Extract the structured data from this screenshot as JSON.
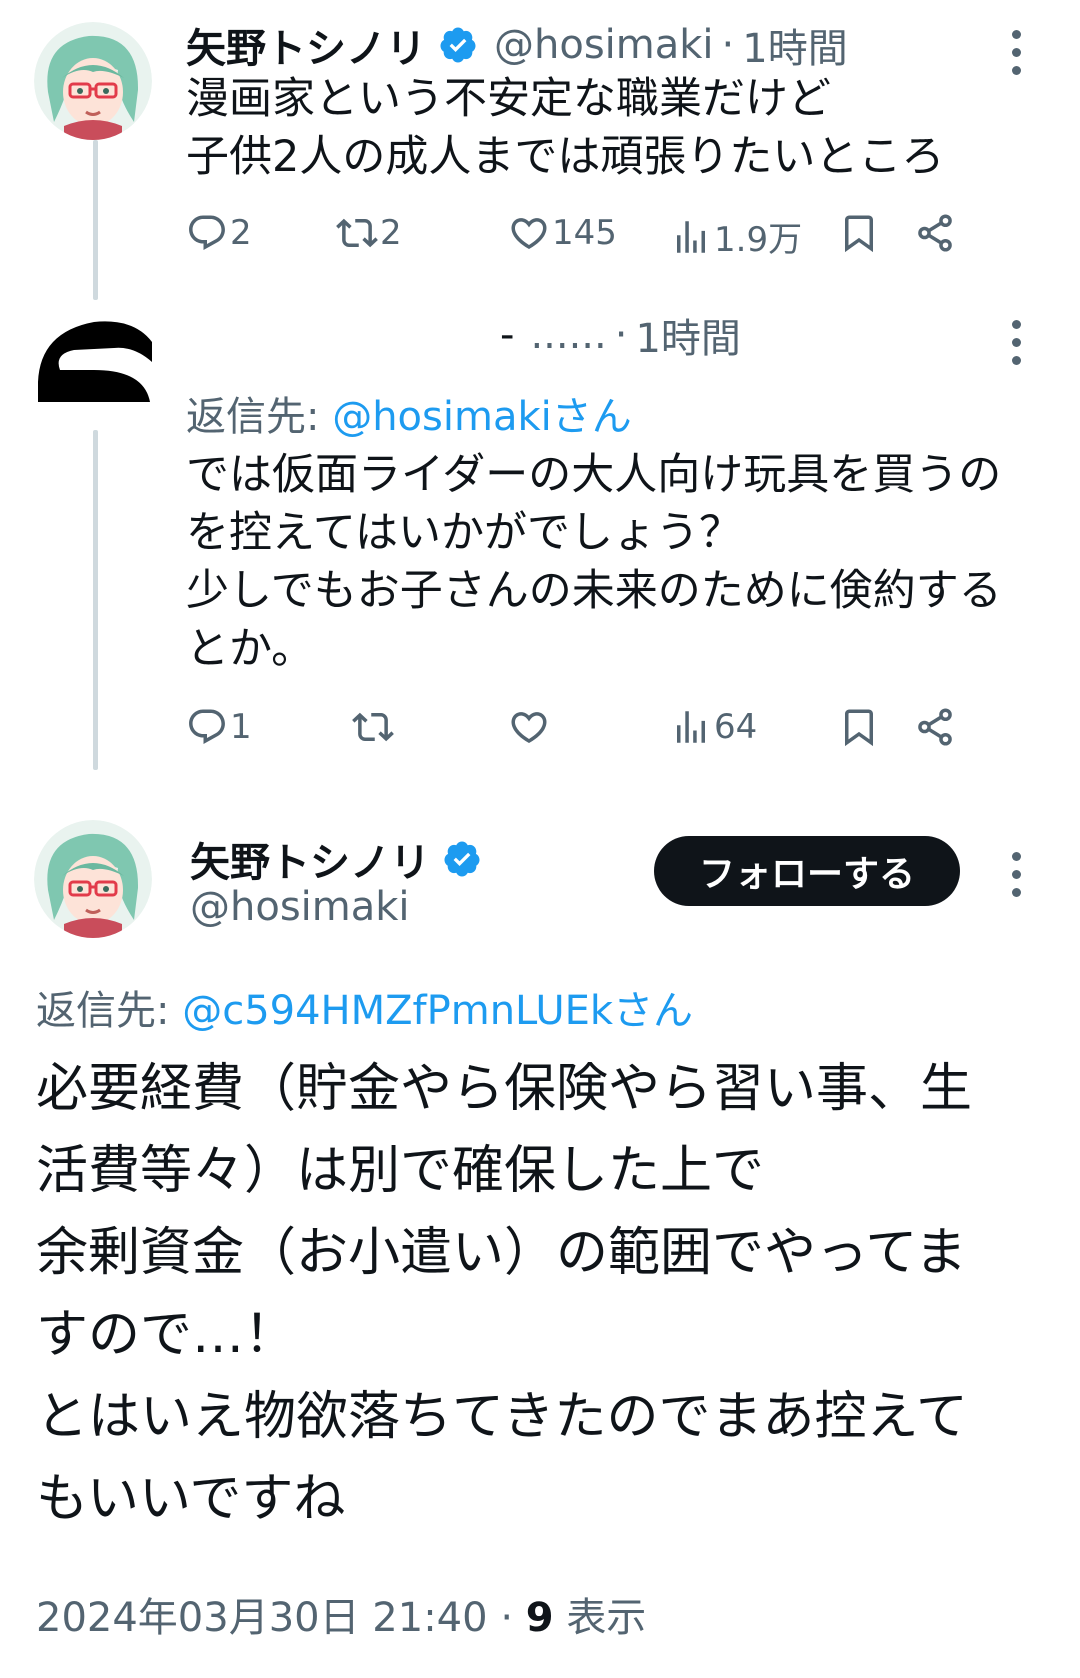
{
  "tweet1": {
    "name": "矢野トシノリ",
    "handle": "@hosimaki",
    "time": "1時間",
    "lines": [
      "漫画家という不安定な職業だけど",
      "子供2人の成人までは頑張りたいところ"
    ],
    "replies": "2",
    "retweets": "2",
    "likes": "145",
    "views": "1.9万"
  },
  "tweet2": {
    "name_fragment": "-",
    "handle_fragment": "......",
    "time": "1時間",
    "replying_prefix": "返信先: ",
    "replying_to": "@hosimakiさん",
    "lines": [
      "では仮面ライダーの大人向け玩具を買うの",
      "を控えてはいかがでしょう？",
      "少しでもお子さんの未来のために倹約する",
      "とか。"
    ],
    "replies": "1",
    "views": "64"
  },
  "tweet3": {
    "name": "矢野トシノリ",
    "handle": "@hosimaki",
    "follow_label": "フォローする",
    "replying_prefix": "返信先: ",
    "replying_to": "@c594HMZfPmnLUEkさん",
    "lines": [
      "必要経費（貯金やら保険やら習い事、生",
      "活費等々）は別で確保した上で",
      "余剰資金（お小遣い）の範囲でやってま",
      "すので…！",
      "とはいえ物欲落ちてきたのでまあ控えて",
      "もいいですね"
    ],
    "timestamp": "2024年03月30日 21:40",
    "separator": "·",
    "view_count": "9",
    "view_label": "表示"
  },
  "colors": {
    "text": "#0f1419",
    "secondary": "#536471",
    "link": "#1d9bf0",
    "verified": "#1d9bf0",
    "thread_line": "#cfd9de"
  }
}
